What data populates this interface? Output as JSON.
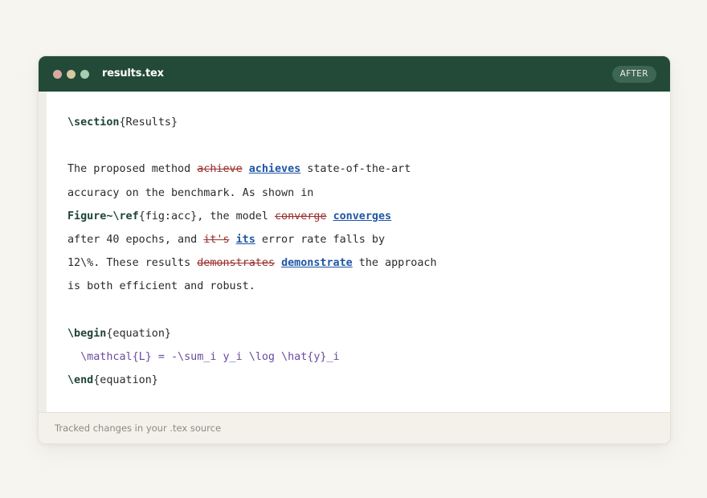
{
  "window": {
    "filename": "results.tex",
    "badge": "AFTER",
    "footer": "Tracked changes in your .tex source"
  },
  "code": {
    "l1": {
      "cmd": "\\section",
      "arg": "{Results}"
    },
    "l3": {
      "a": "The proposed method ",
      "del": "achieve",
      "ins": "achieves",
      "b": " state-of-the-art"
    },
    "l4": {
      "a": "accuracy on the benchmark. As shown in"
    },
    "l5": {
      "cmd": "Figure~\\ref",
      "a": "{fig:acc}, the model ",
      "del": "converge",
      "ins": "converges"
    },
    "l6": {
      "a": "after 40 epochs, and ",
      "del": "it's",
      "ins": "its",
      "b": " error rate falls by"
    },
    "l7": {
      "a": "12\\%. These results ",
      "del": "demonstrates",
      "ins": "demonstrate",
      "b": " the approach"
    },
    "l8": {
      "a": "is both efficient and robust."
    },
    "l10": {
      "cmd": "\\begin",
      "arg": "{equation}"
    },
    "l11": {
      "math": "  \\mathcal{L} = -\\sum_i y_i \\log \\hat{y}_i"
    },
    "l12": {
      "cmd": "\\end",
      "arg": "{equation}"
    }
  }
}
